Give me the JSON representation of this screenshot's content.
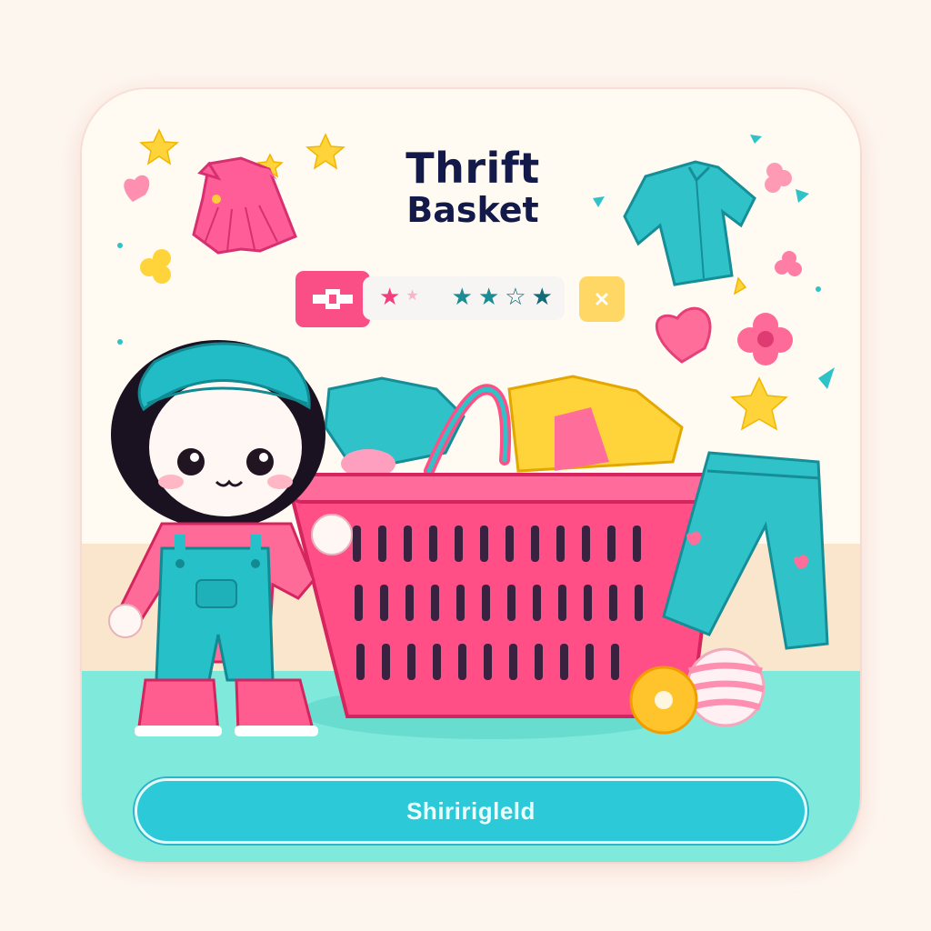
{
  "title": {
    "line1": "Thrift",
    "line2": "Basket"
  },
  "rating_bar": {
    "left_icon": "puzzle-cross-icon",
    "stars_icon": "star-icon",
    "close_icon": "close-icon",
    "star_colors": [
      "#f43d7c",
      "#f9b5c6",
      "#1a8c94",
      "#1a8c94",
      "#136b79",
      "#136b79"
    ]
  },
  "cta": {
    "label": "Shiririgleld"
  },
  "colors": {
    "accent_pink": "#fa4f86",
    "accent_teal": "#2cc9d8",
    "accent_yellow": "#ffd765",
    "title_navy": "#131a4a"
  }
}
